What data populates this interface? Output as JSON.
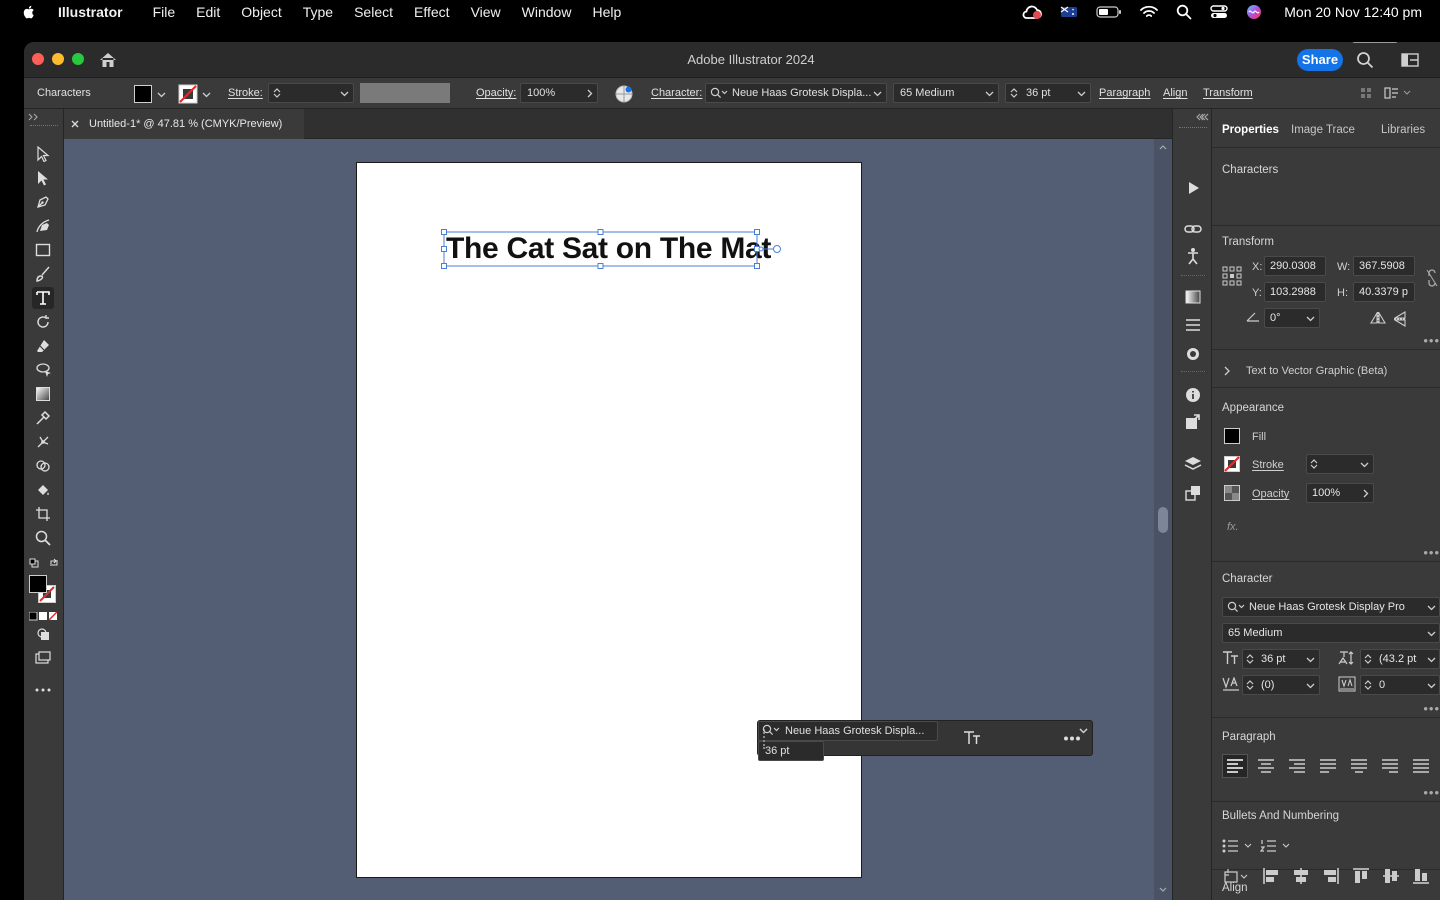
{
  "menubar": {
    "app": "Illustrator",
    "items": [
      "File",
      "Edit",
      "Object",
      "Type",
      "Select",
      "Effect",
      "View",
      "Window",
      "Help"
    ],
    "clock": "Mon 20 Nov  12:40 pm"
  },
  "window": {
    "title": "Adobe Illustrator 2024",
    "share_label": "Share"
  },
  "control_bar": {
    "selection": "Characters",
    "stroke_label": "Stroke:",
    "opacity_label": "Opacity:",
    "opacity_value": "100%",
    "character_label": "Character:",
    "font_family": "Neue Haas Grotesk Displa...",
    "font_style": "65 Medium",
    "font_size": "36 pt",
    "paragraph": "Paragraph",
    "align": "Align",
    "transform": "Transform"
  },
  "document": {
    "tab_label": "Untitled-1* @ 47.81 % (CMYK/Preview)",
    "headline": "The Cat Sat on The Mat"
  },
  "contextual_bar": {
    "font_family": "Neue Haas Grotesk Displa...",
    "font_size": "36 pt"
  },
  "panel": {
    "tabs": [
      "Properties",
      "Image Trace",
      "Libraries"
    ],
    "active_tab": "Properties",
    "object_type": "Characters",
    "transform": {
      "heading": "Transform",
      "x_label": "X:",
      "x": "290.0308",
      "y_label": "Y:",
      "y": "103.2988",
      "w_label": "W:",
      "w": "367.5908",
      "h_label": "H:",
      "h": "40.3379 p",
      "angle": "0°"
    },
    "text_to_vector": "Text to Vector Graphic (Beta)",
    "appearance": {
      "heading": "Appearance",
      "fill": "Fill",
      "stroke": "Stroke",
      "opacity_label": "Opacity",
      "opacity_value": "100%",
      "fx": "fx."
    },
    "character": {
      "heading": "Character",
      "font_family": "Neue Haas Grotesk Display Pro",
      "font_style": "65 Medium",
      "font_size": "36 pt",
      "leading": "(43.2 pt",
      "kerning": "(0)",
      "tracking": "0"
    },
    "paragraph_heading": "Paragraph",
    "bullets_heading": "Bullets And Numbering",
    "align_heading": "Align"
  },
  "colors": {
    "canvas": "#535e74",
    "accent": "#1473e6",
    "selection": "#4a7fd6"
  }
}
